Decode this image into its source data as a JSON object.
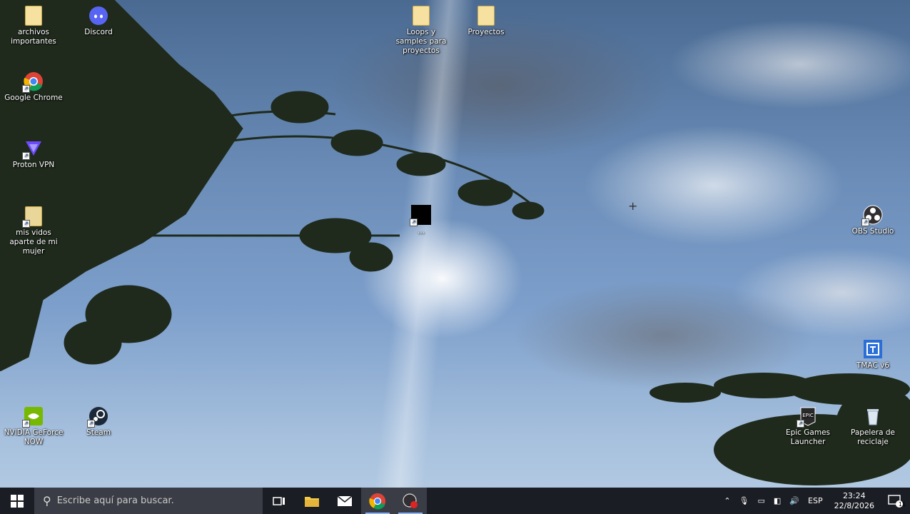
{
  "desktop": {
    "icons": {
      "archivos": "archivos importantes",
      "discord": "Discord",
      "chrome": "Google Chrome",
      "proton": "Proton VPN",
      "videos": "mis vidos aparte de mi mujer",
      "nvidia": "NVIDIA GeForce NOW",
      "steam": "Steam",
      "loops": "Loops y samples para proyectos",
      "proyectos": "Proyectos",
      "center": "...",
      "obs": "OBS Studio",
      "tmac": "TMAC v6",
      "epic": "Epic Games Launcher",
      "recycle": "Papelera de reciclaje"
    }
  },
  "taskbar": {
    "search_placeholder": "Escribe aquí para buscar.",
    "language": "ESP",
    "time": "23:24",
    "date": "22/8/2026",
    "notification_count": "11"
  },
  "colors": {
    "taskbar_bg": "#1b1d24",
    "search_bg": "#3a3d45",
    "accent": "#8ab4f8"
  }
}
